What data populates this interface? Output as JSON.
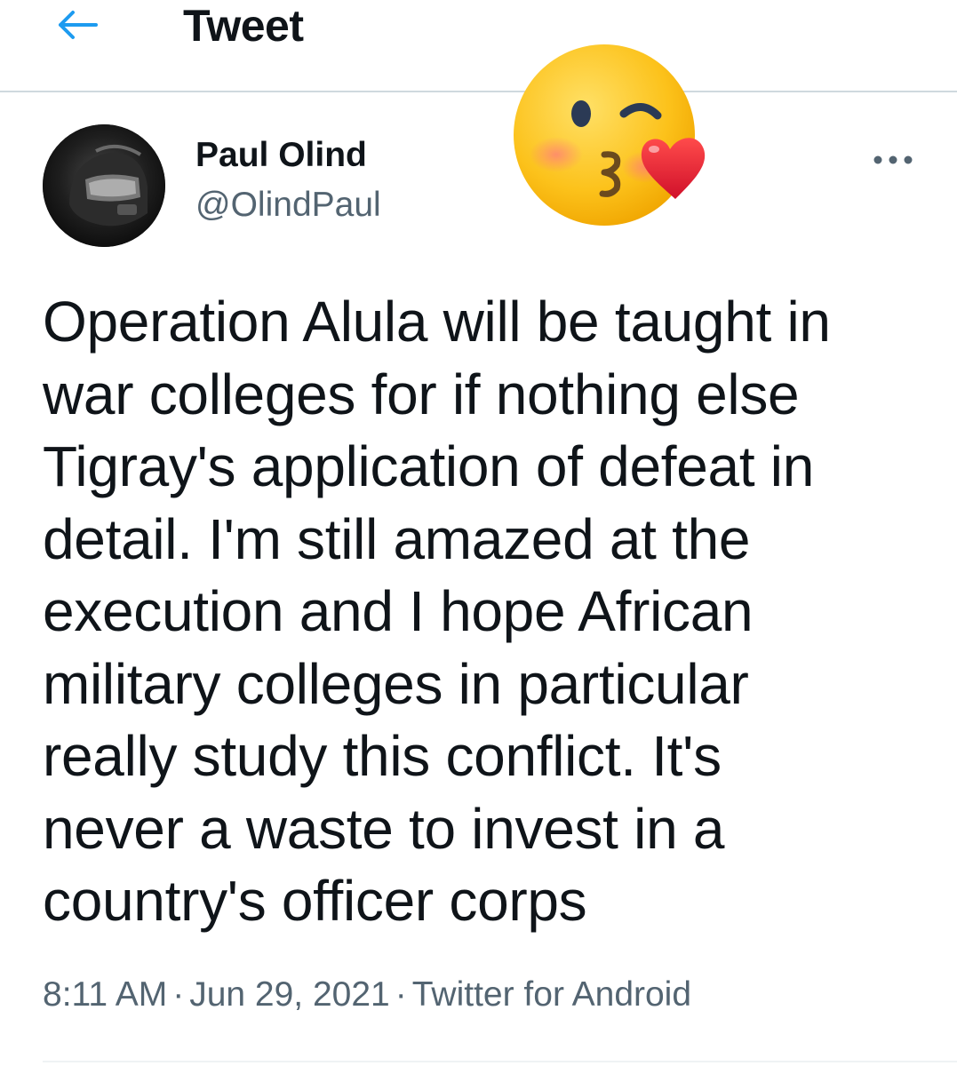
{
  "header": {
    "back_icon": "arrow-left-icon",
    "title": "Tweet",
    "accent_color": "#1d9bf0"
  },
  "author": {
    "name": "Paul Olind",
    "handle": "@OlindPaul",
    "avatar_icon": "avatar-image",
    "more_icon": "more-horizontal-icon"
  },
  "overlay": {
    "emoji_icon": "face-blowing-a-kiss-emoji"
  },
  "tweet": {
    "text": "Operation Alula will be taught in\nwar colleges for if nothing else\nTigray's application of defeat in\ndetail. I'm still amazed at the\nexecution and I hope African\nmilitary colleges in particular\nreally study this conflict. It's\nnever a waste to invest in a\ncountry's officer corps",
    "time": "8:11 AM",
    "separator": "·",
    "date": "Jun 29, 2021",
    "source": "Twitter for Android"
  }
}
